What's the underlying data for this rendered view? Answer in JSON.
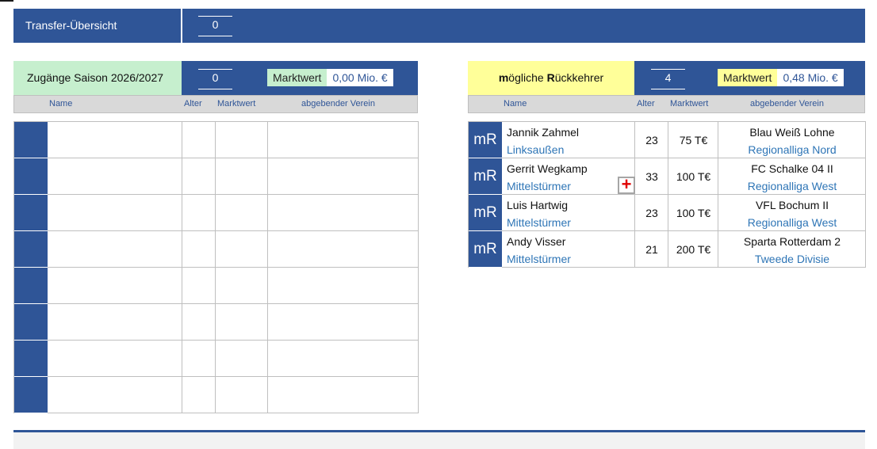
{
  "overview": {
    "title": "Transfer-Übersicht",
    "count": "0"
  },
  "arrivals": {
    "title": "Zugänge Saison 2026/2027",
    "count": "0",
    "market_label": "Marktwert",
    "market_value": "0,00 Mio. €",
    "columns": {
      "name": "Name",
      "age": "Alter",
      "value": "Marktwert",
      "club": "abgebender Verein"
    }
  },
  "returners": {
    "title_parts": [
      "m",
      "ögliche ",
      "R",
      "ückkehrer"
    ],
    "count": "4",
    "market_label": "Marktwert",
    "market_value": "0,48 Mio. €",
    "columns": {
      "name": "Name",
      "age": "Alter",
      "value": "Marktwert",
      "club": "abgebender Verein"
    },
    "rows": [
      {
        "tag": "mR",
        "name": "Jannik Zahmel",
        "position": "Linksaußen",
        "age": "23",
        "value": "75 T€",
        "club": "Blau Weiß Lohne",
        "league": "Regionalliga Nord"
      },
      {
        "tag": "mR",
        "name": "Gerrit Wegkamp",
        "position": "Mittelstürmer",
        "age": "33",
        "value": "100 T€",
        "club": "FC Schalke 04 II",
        "league": "Regionalliga West"
      },
      {
        "tag": "mR",
        "name": "Luis Hartwig",
        "position": "Mittelstürmer",
        "age": "23",
        "value": "100 T€",
        "club": "VFL Bochum II",
        "league": "Regionalliga West"
      },
      {
        "tag": "mR",
        "name": "Andy Visser",
        "position": "Mittelstürmer",
        "age": "21",
        "value": "200 T€",
        "club": "Sparta Rotterdam 2",
        "league": "Tweede Divisie"
      }
    ]
  },
  "colors": {
    "header_blue": "#2f5597",
    "green": "#c6efce",
    "yellow": "#ffff99",
    "link_blue": "#2e75b6"
  }
}
